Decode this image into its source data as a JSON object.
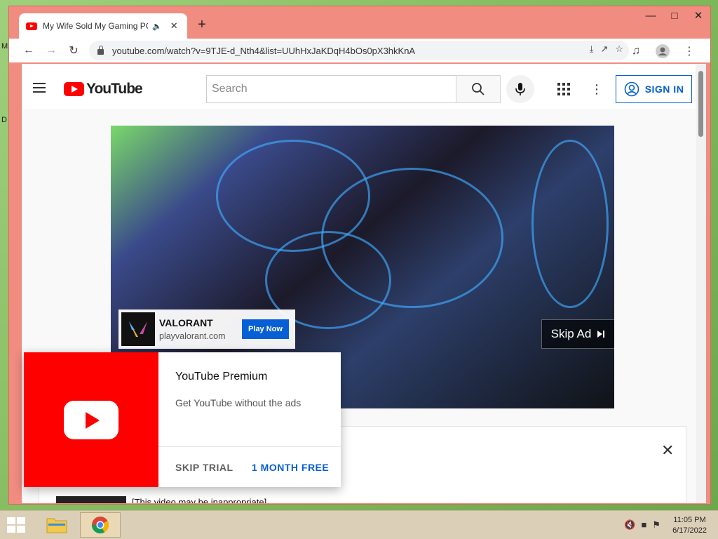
{
  "browser": {
    "tab_title": "My Wife Sold My Gaming PC",
    "url": "youtube.com/watch?v=9TJE-d_Nth4&list=UUhHxJaKDqH4bOs0pX3hkKnA"
  },
  "youtube": {
    "logo_text": "YouTube",
    "search_placeholder": "Search",
    "sign_in_label": "SIGN IN"
  },
  "ad": {
    "brand": "VALORANT",
    "domain": "playvalorant.com",
    "cta": "Play Now",
    "skip_label": "Skip Ad"
  },
  "premium_popup": {
    "title": "YouTube Premium",
    "subtitle": "Get YouTube without the ads",
    "skip_label": "SKIP TRIAL",
    "accept_label": "1 MONTH FREE"
  },
  "below_video": {
    "notice": "[This video may be inappropriate]"
  },
  "taskbar": {
    "time": "11:05 PM",
    "date": "6/17/2022"
  },
  "colors": {
    "brand_red": "#ff0000",
    "link_blue": "#065fd4",
    "window_frame": "#f08c80"
  }
}
